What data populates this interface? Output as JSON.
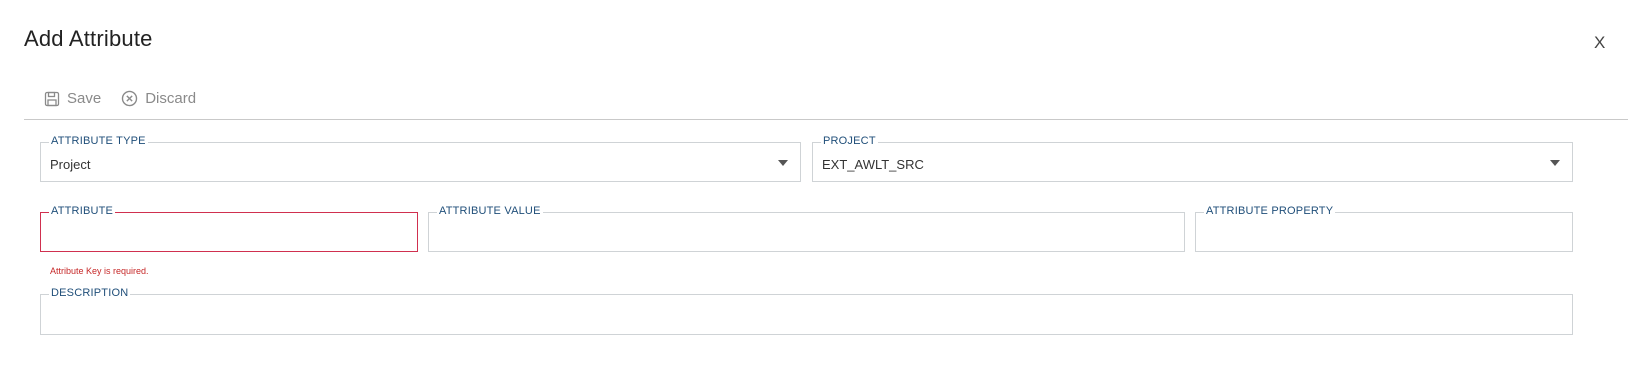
{
  "dialog": {
    "title": "Add Attribute",
    "close_label": "X"
  },
  "toolbar": {
    "save_label": "Save",
    "discard_label": "Discard"
  },
  "form": {
    "attribute_type": {
      "label": "ATTRIBUTE TYPE",
      "value": "Project"
    },
    "project": {
      "label": "PROJECT",
      "value": "EXT_AWLT_SRC"
    },
    "attribute": {
      "label": "ATTRIBUTE",
      "value": "",
      "error": "Attribute Key is required."
    },
    "attribute_value": {
      "label": "ATTRIBUTE VALUE",
      "value": ""
    },
    "attribute_property": {
      "label": "ATTRIBUTE PROPERTY",
      "value": ""
    },
    "description": {
      "label": "DESCRIPTION",
      "value": ""
    }
  },
  "colors": {
    "label": "#1f4e79",
    "error": "#d0304f",
    "toolbar_text": "#8a8a8a"
  },
  "icons": {
    "save": "floppy-disk-icon",
    "discard": "circle-x-icon",
    "dropdown": "caret-down-icon"
  }
}
